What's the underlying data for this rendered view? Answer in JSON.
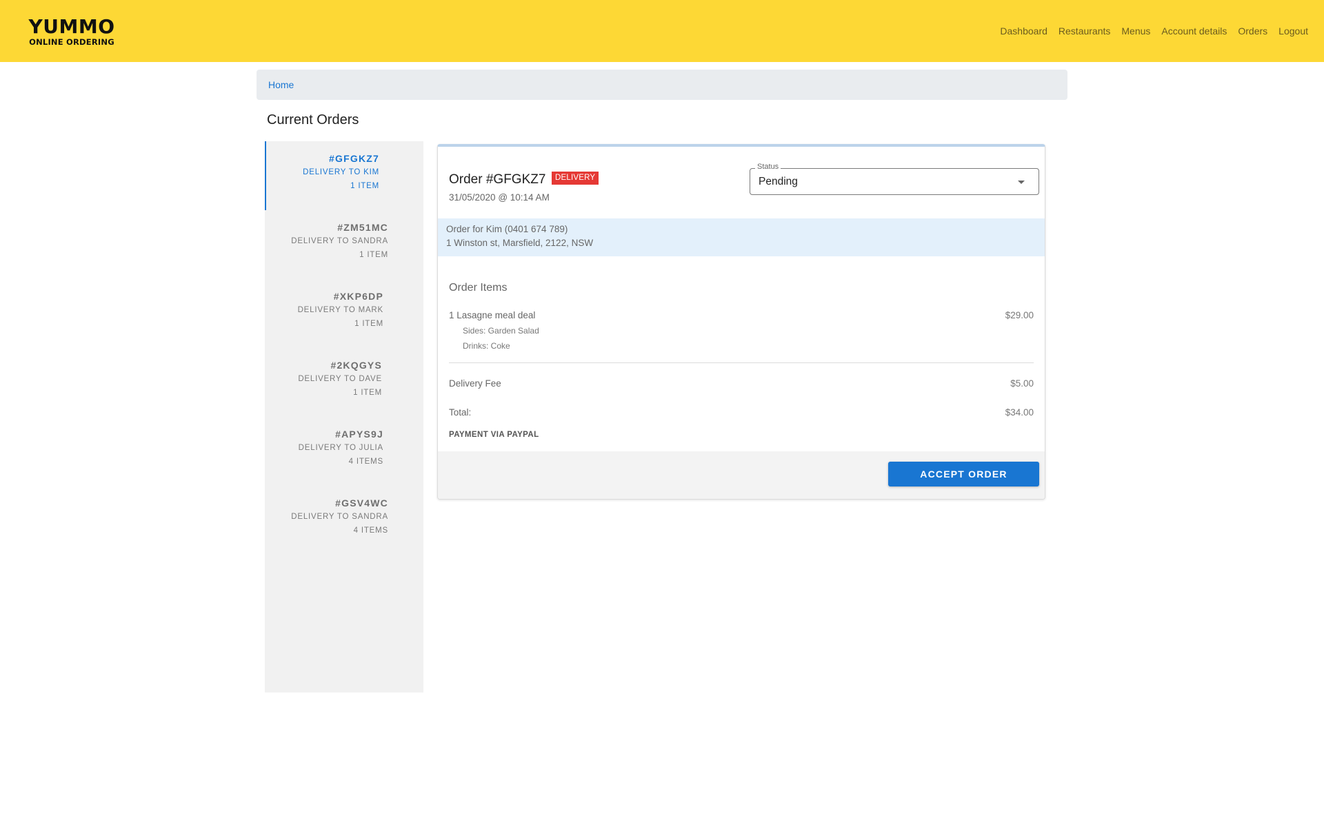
{
  "brand": {
    "name": "YUMMO",
    "tagline": "ONLINE ORDERING"
  },
  "nav": [
    "Dashboard",
    "Restaurants",
    "Menus",
    "Account details",
    "Orders",
    "Logout"
  ],
  "breadcrumb": {
    "home": "Home"
  },
  "page_title": "Current Orders",
  "orders": [
    {
      "code": "#GFGKZ7",
      "delivery": "DELIVERY TO KIM",
      "items": "1 ITEM",
      "active": true
    },
    {
      "code": "#ZM51MC",
      "delivery": "DELIVERY TO SANDRA",
      "items": "1 ITEM",
      "active": false
    },
    {
      "code": "#XKP6DP",
      "delivery": "DELIVERY TO MARK",
      "items": "1 ITEM",
      "active": false
    },
    {
      "code": "#2KQGYS",
      "delivery": "DELIVERY TO DAVE",
      "items": "1 ITEM",
      "active": false
    },
    {
      "code": "#APYS9J",
      "delivery": "DELIVERY TO JULIA",
      "items": "4 ITEMS",
      "active": false
    },
    {
      "code": "#GSV4WC",
      "delivery": "DELIVERY TO SANDRA",
      "items": "4 ITEMS",
      "active": false
    }
  ],
  "detail": {
    "title": "Order #GFGKZ7",
    "badge": "DELIVERY",
    "datetime": "31/05/2020 @ 10:14 AM",
    "status_label": "Status",
    "status_value": "Pending",
    "customer_line1": "Order for Kim (0401 674 789)",
    "customer_line2": "1 Winston st, Marsfield, 2122, NSW",
    "items_title": "Order Items",
    "items": [
      {
        "name": "1 Lasagne meal deal",
        "price": "$29.00",
        "options": [
          "Sides: Garden Salad",
          "Drinks: Coke"
        ]
      }
    ],
    "delivery_fee_label": "Delivery Fee",
    "delivery_fee": "$5.00",
    "total_label": "Total:",
    "total": "$34.00",
    "payment": "PAYMENT VIA PAYPAL",
    "accept_label": "ACCEPT ORDER"
  },
  "colors": {
    "header": "#fdd835",
    "accent": "#1976d2",
    "badge": "#e53935",
    "customer_bg": "#e3f0fb"
  }
}
